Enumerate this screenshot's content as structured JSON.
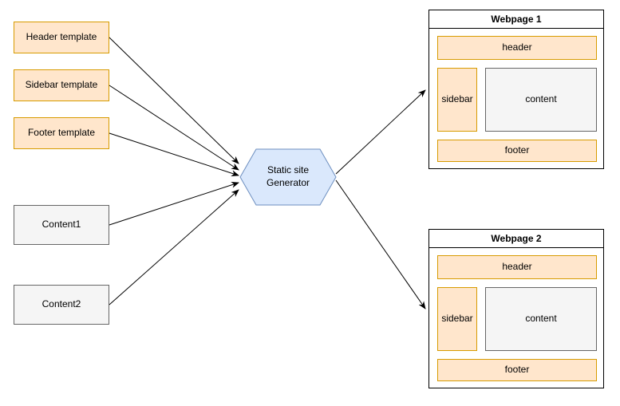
{
  "inputs": {
    "header_template": "Header template",
    "sidebar_template": "Sidebar template",
    "footer_template": "Footer template",
    "content1": "Content1",
    "content2": "Content2"
  },
  "processor": {
    "label": "Static site\nGenerator",
    "fill": "#dae8fc",
    "stroke": "#6c8ebf"
  },
  "webpages": [
    {
      "title": "Webpage 1",
      "header": "header",
      "sidebar": "sidebar",
      "content": "content",
      "footer": "footer"
    },
    {
      "title": "Webpage 2",
      "header": "header",
      "sidebar": "sidebar",
      "content": "content",
      "footer": "footer"
    }
  ],
  "colors": {
    "orange_fill": "#ffe6cc",
    "orange_stroke": "#d79b00",
    "gray_fill": "#f5f5f5",
    "gray_stroke": "#666666"
  }
}
